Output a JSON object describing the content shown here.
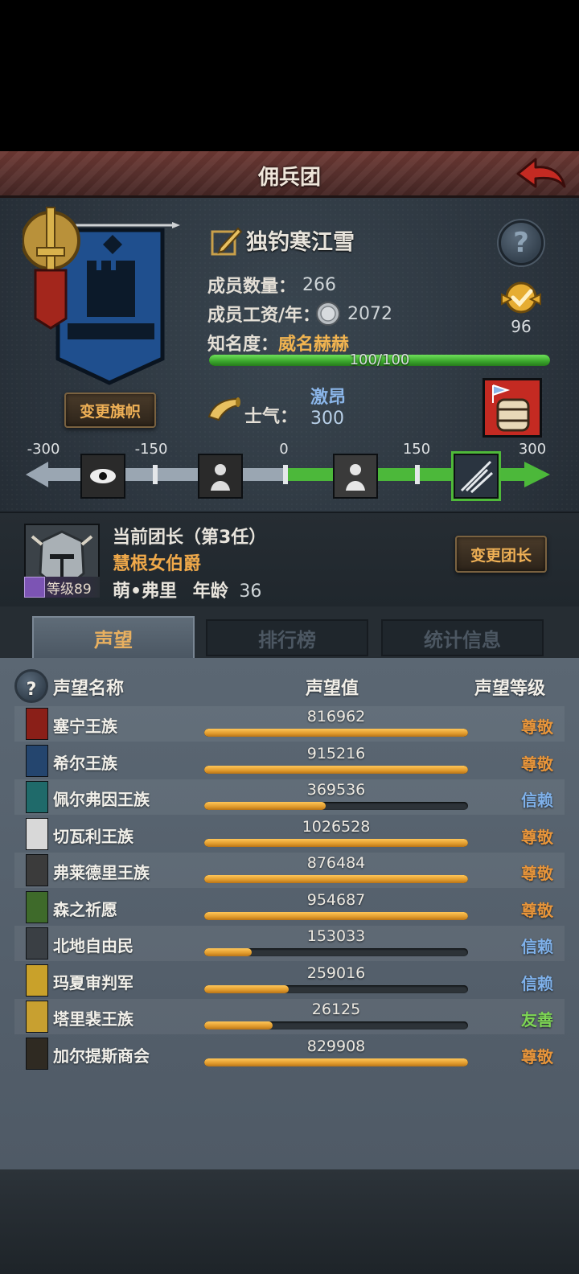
{
  "header": {
    "title": "佣兵团"
  },
  "merc": {
    "name": "独钓寒江雪",
    "members_label": "成员数量：",
    "members_value": "266",
    "salary_label": "成员工资/年：",
    "salary_value": "2072",
    "fame_label": "知名度：",
    "fame_value": "威名赫赫",
    "fame_progress_text": "100/100",
    "fame_progress": 1.0,
    "rank_value": "96",
    "change_banner_label": "变更旗帜"
  },
  "morale": {
    "label": "士气：",
    "state": "激昂",
    "value": "300",
    "ticks": [
      "-300",
      "-150",
      "0",
      "150",
      "300"
    ],
    "level": 300
  },
  "commander": {
    "title": "当前团长（第3任）",
    "rank_name": "慧根女伯爵",
    "name": "萌•弗里",
    "age_label": "年龄",
    "age": "36",
    "level_text": "等级89",
    "change_label": "变更团长"
  },
  "tabs": [
    "声望",
    "排行榜",
    "统计信息"
  ],
  "reputation": {
    "headers": {
      "name": "声望名称",
      "value": "声望值",
      "level": "声望等级"
    },
    "rows": [
      {
        "name": "塞宁王族",
        "value": "816962",
        "level": "尊敬",
        "fill": 1.0,
        "color": "#e8953a",
        "crest": "#8a1f18"
      },
      {
        "name": "希尔王族",
        "value": "915216",
        "level": "尊敬",
        "fill": 1.0,
        "color": "#e8953a",
        "crest": "#24456e"
      },
      {
        "name": "佩尔弗因王族",
        "value": "369536",
        "level": "信赖",
        "fill": 0.46,
        "color": "#7fb1ea",
        "crest": "#1f6a6a"
      },
      {
        "name": "切瓦利王族",
        "value": "1026528",
        "level": "尊敬",
        "fill": 1.0,
        "color": "#e8953a",
        "crest": "#d8d8d8"
      },
      {
        "name": "弗莱德里王族",
        "value": "876484",
        "level": "尊敬",
        "fill": 1.0,
        "color": "#e8953a",
        "crest": "#3b3b3b"
      },
      {
        "name": "森之祈愿",
        "value": "954687",
        "level": "尊敬",
        "fill": 1.0,
        "color": "#e8953a",
        "crest": "#3e6a2a"
      },
      {
        "name": "北地自由民",
        "value": "153033",
        "level": "信赖",
        "fill": 0.18,
        "color": "#7fb1ea",
        "crest": "#3a3f44"
      },
      {
        "name": "玛夏审判军",
        "value": "259016",
        "level": "信赖",
        "fill": 0.32,
        "color": "#7fb1ea",
        "crest": "#c9a12a"
      },
      {
        "name": "塔里裴王族",
        "value": "26125",
        "level": "友善",
        "fill": 0.26,
        "color": "#7ed654",
        "crest": "#c8a030"
      },
      {
        "name": "加尔提斯商会",
        "value": "829908",
        "level": "尊敬",
        "fill": 1.0,
        "color": "#e8953a",
        "crest": "#2f2a22"
      }
    ]
  }
}
